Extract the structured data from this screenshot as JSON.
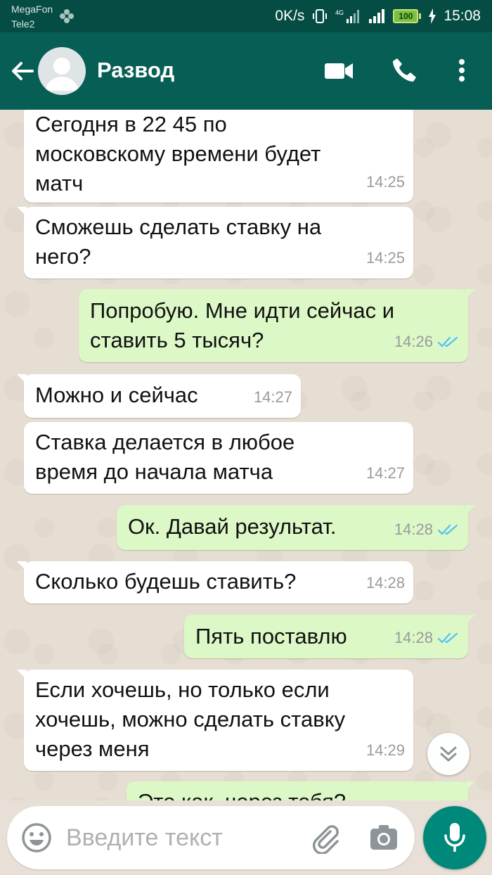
{
  "status_bar": {
    "carrier_1": "MegaFon",
    "carrier_2": "Tele2",
    "net_speed": "0K/s",
    "battery": "100",
    "time": "15:08"
  },
  "header": {
    "contact_name": "Развод"
  },
  "messages": [
    {
      "direction": "in",
      "text": "Сегодня в 22 45 по\nмосковскому времени будет\nматч",
      "time": "14:25"
    },
    {
      "direction": "in",
      "text": "Сможешь сделать ставку на\nнего?",
      "time": "14:25"
    },
    {
      "direction": "out",
      "text": "Попробую. Мне идти сейчас и\nставить 5 тысяч?",
      "time": "14:26",
      "status": "read"
    },
    {
      "direction": "in",
      "text": "Можно и сейчас",
      "time": "14:27"
    },
    {
      "direction": "in",
      "text": "Ставка делается в любое\nвремя до начала матча",
      "time": "14:27"
    },
    {
      "direction": "out",
      "text": "Ок. Давай результат.",
      "time": "14:28",
      "status": "read"
    },
    {
      "direction": "in",
      "text": "Сколько будешь ставить?",
      "time": "14:28"
    },
    {
      "direction": "out",
      "text": "Пять поставлю",
      "time": "14:28",
      "status": "read"
    },
    {
      "direction": "in",
      "text": "Если хочешь, но только если\nхочешь, можно сделать ставку\nчерез меня",
      "time": "14:29"
    },
    {
      "direction": "out",
      "text": "Это как, через тебя?",
      "time": ""
    }
  ],
  "input": {
    "placeholder": "Введите текст",
    "value": ""
  },
  "colors": {
    "header_bg": "#075e54",
    "status_bg": "#054d44",
    "incoming_bubble": "#ffffff",
    "outgoing_bubble": "#dcf8c6",
    "read_ticks": "#4fc3f7",
    "mic_button": "#00897b"
  },
  "icons": {
    "back": "arrow-left-icon",
    "avatar": "default-avatar-icon",
    "video": "video-camera-icon",
    "call": "phone-icon",
    "menu": "more-vertical-icon",
    "scroll_down": "double-chevron-down-icon",
    "emoji": "smiley-icon",
    "attach": "paperclip-icon",
    "camera": "camera-icon",
    "mic": "microphone-icon"
  }
}
